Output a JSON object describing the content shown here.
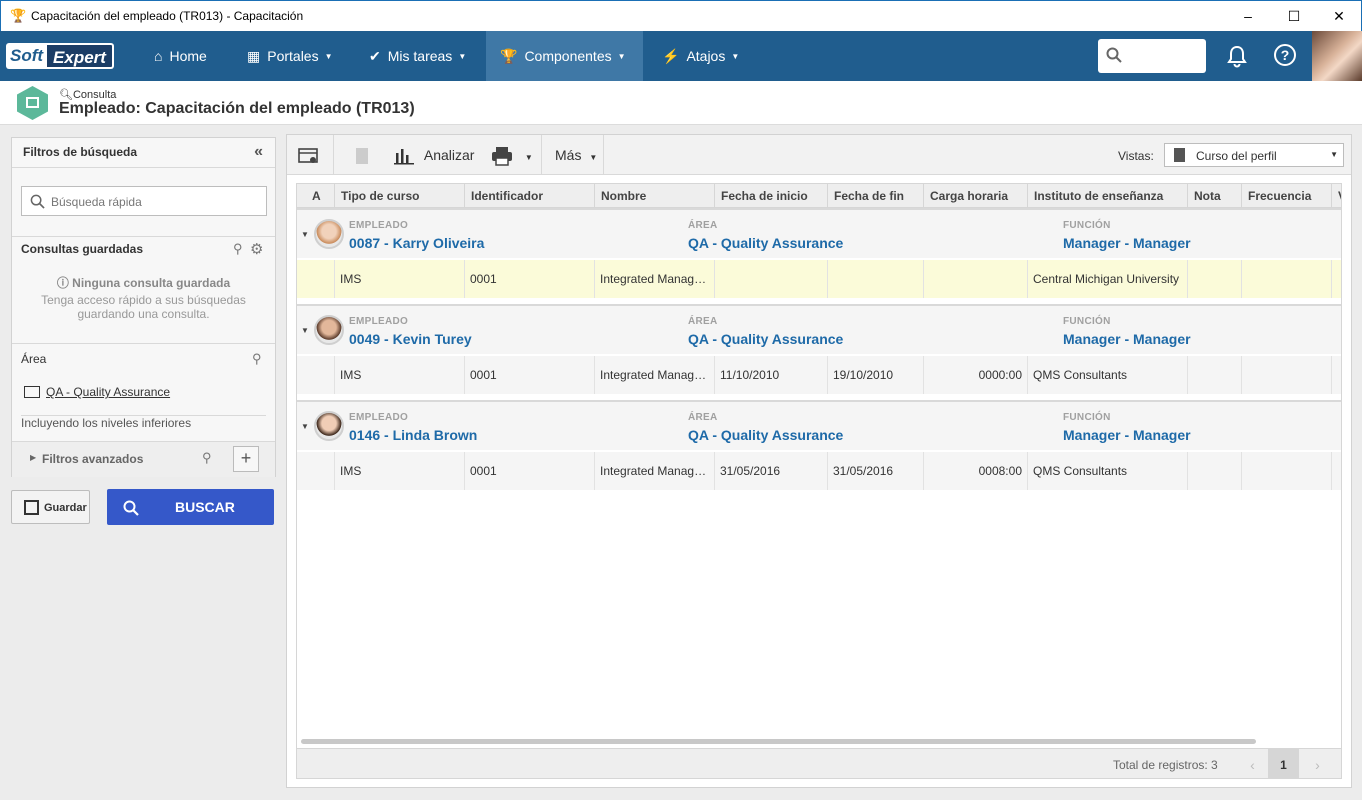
{
  "window": {
    "title": "Capacitación del empleado (TR013) - Capacitación",
    "minimize": "–",
    "maximize": "☐",
    "close": "✕"
  },
  "navbar": {
    "logo_left": "Soft",
    "logo_right": "Expert",
    "items": [
      {
        "label": "Home",
        "icon": "home-icon",
        "glyph": "⌂"
      },
      {
        "label": "Portales",
        "icon": "grid-icon",
        "glyph": "▦"
      },
      {
        "label": "Mis tareas",
        "icon": "check-icon",
        "glyph": "✔"
      },
      {
        "label": "Componentes",
        "icon": "trophy-icon",
        "glyph": "🏆"
      },
      {
        "label": "Atajos",
        "icon": "bolt-icon",
        "glyph": "⚡"
      }
    ],
    "search_placeholder": ""
  },
  "page_header": {
    "subtitle": "Consulta",
    "title": "Empleado: Capacitación del empleado (TR013)"
  },
  "left_panel": {
    "title": "Filtros de búsqueda",
    "quick_search_placeholder": "Búsqueda rápida",
    "saved_queries_title": "Consultas guardadas",
    "no_saved": "Ninguna consulta guardada",
    "no_saved_hint": "Tenga acceso rápido a sus búsquedas guardando una consulta.",
    "area_title": "Área",
    "area_value": "QA - Quality Assurance",
    "include_lower": "Incluyendo los niveles inferiores",
    "advanced_filters": "Filtros avanzados",
    "save_label": "Guardar",
    "search_label": "BUSCAR"
  },
  "toolbar": {
    "analyze_label": "Analizar",
    "more_label": "Más",
    "views_label": "Vistas:",
    "views_value": "Curso del perfil"
  },
  "grid": {
    "columns": [
      "A",
      "Tipo de curso",
      "Identificador",
      "Nombre",
      "Fecha de inicio",
      "Fecha de fin",
      "Carga horaria",
      "Instituto de enseñanza",
      "Nota",
      "Frecuencia",
      "V"
    ],
    "group_labels": {
      "employee": "EMPLEADO",
      "area": "ÁREA",
      "role": "FUNCIÓN"
    },
    "groups": [
      {
        "employee": "0087 - Karry Oliveira",
        "area": "QA - Quality Assurance",
        "role": "Manager - Manager",
        "row": {
          "tipo": "IMS",
          "id": "0001",
          "nombre": "Integrated Manag…",
          "inicio": "",
          "fin": "",
          "carga": "",
          "instituto": "Central Michigan University"
        }
      },
      {
        "employee": "0049 - Kevin Turey",
        "area": "QA - Quality Assurance",
        "role": "Manager - Manager",
        "row": {
          "tipo": "IMS",
          "id": "0001",
          "nombre": "Integrated Manag…",
          "inicio": "11/10/2010",
          "fin": "19/10/2010",
          "carga": "0000:00",
          "instituto": "QMS Consultants"
        }
      },
      {
        "employee": "0146 - Linda Brown",
        "area": "QA - Quality Assurance",
        "role": "Manager - Manager",
        "row": {
          "tipo": "IMS",
          "id": "0001",
          "nombre": "Integrated Manag…",
          "inicio": "31/05/2016",
          "fin": "31/05/2016",
          "carga": "0008:00",
          "instituto": "QMS Consultants"
        }
      }
    ],
    "total_label": "Total de registros: 3",
    "current_page": "1"
  },
  "colors": {
    "navbar": "#205d8e",
    "accent_link": "#1e6aa8",
    "search_button": "#3558c9",
    "highlight_row": "#fbfbd9"
  }
}
